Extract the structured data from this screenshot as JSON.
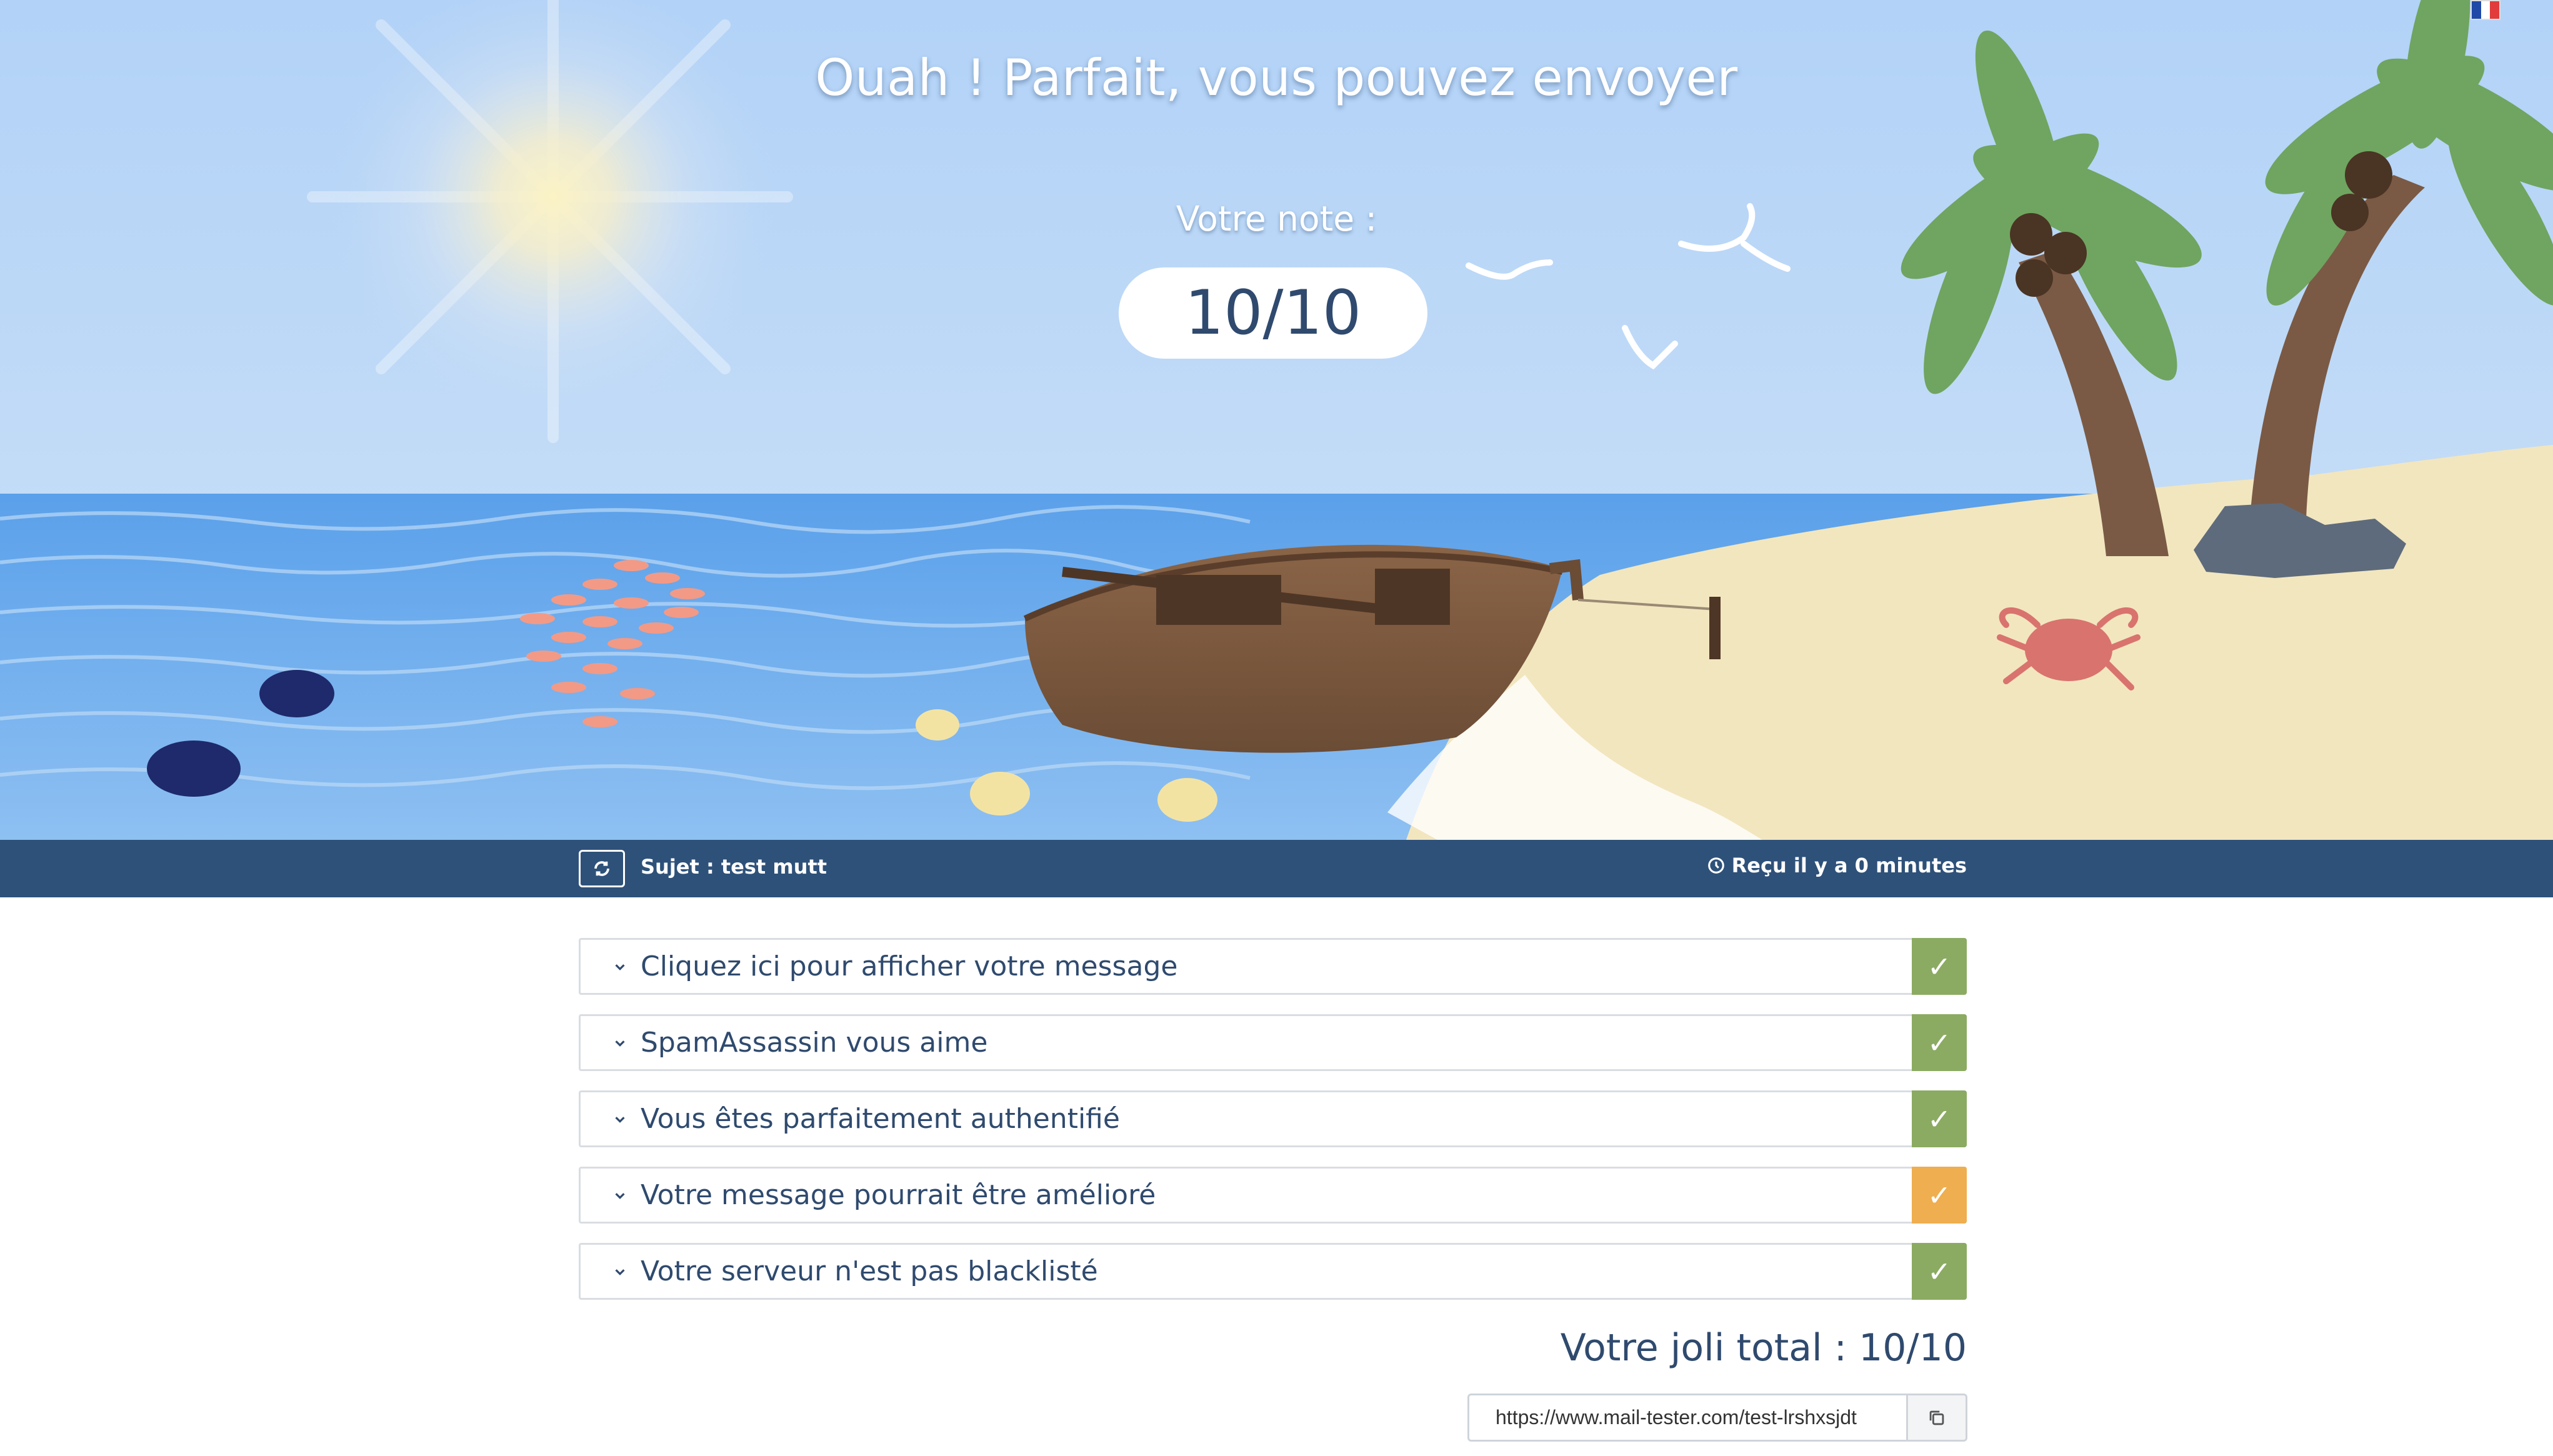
{
  "hero": {
    "title": "Ouah ! Parfait, vous pouvez envoyer",
    "score_label": "Votre note :",
    "score_value": "10/10"
  },
  "language": {
    "flag": "fr-flag-icon",
    "colors": [
      "#1f4aa8",
      "#ffffff",
      "#e23b3b"
    ]
  },
  "infobar": {
    "subject": "Sujet : test mutt",
    "received": "Reçu il y a 0 minutes"
  },
  "results": [
    {
      "label": "Cliquez ici pour afficher votre message",
      "status": "ok",
      "color": "#8bab62"
    },
    {
      "label": "SpamAssassin vous aime",
      "status": "ok",
      "color": "#8bab62"
    },
    {
      "label": "Vous êtes parfaitement authentifié",
      "status": "ok",
      "color": "#8bab62"
    },
    {
      "label": "Votre message pourrait être amélioré",
      "status": "warning",
      "color": "#efae4f"
    },
    {
      "label": "Votre serveur n'est pas blacklisté",
      "status": "ok",
      "color": "#8bab62"
    }
  ],
  "total": "Votre joli total : 10/10",
  "share": {
    "url": "https://www.mail-tester.com/test-lrshxsjdt"
  },
  "colors": {
    "brand_dark": "#2e5179",
    "text": "#2f4a6e",
    "ok": "#8bab62",
    "warning": "#efae4f"
  }
}
